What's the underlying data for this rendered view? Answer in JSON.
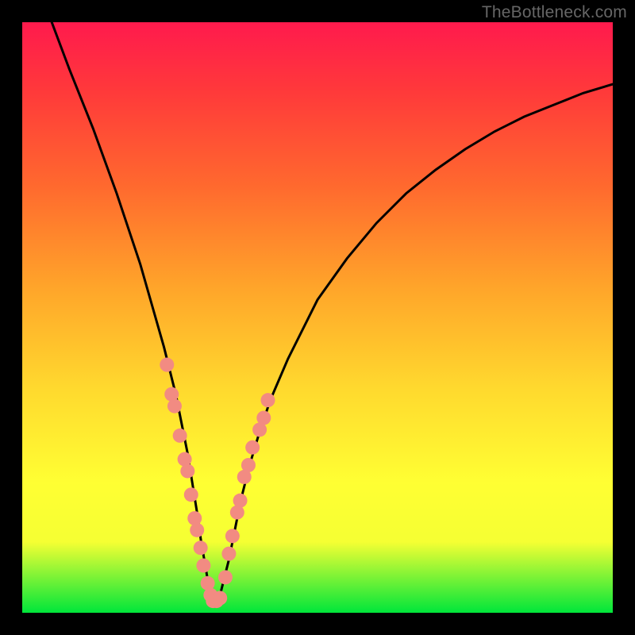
{
  "watermark": "TheBottleneck.com",
  "chart_data": {
    "type": "line",
    "title": "",
    "xlabel": "",
    "ylabel": "",
    "xlim": [
      0,
      100
    ],
    "ylim": [
      0,
      100
    ],
    "series": [
      {
        "name": "bottleneck-curve",
        "x": [
          5,
          8,
          12,
          16,
          20,
          22,
          24,
          26,
          27,
          28,
          28.8,
          29.6,
          30.3,
          31,
          31.5,
          32,
          32.5,
          33,
          33.5,
          34,
          35,
          36,
          37,
          38.5,
          40,
          42,
          45,
          50,
          55,
          60,
          65,
          70,
          75,
          80,
          85,
          90,
          95,
          100
        ],
        "values": [
          100,
          92,
          82,
          71,
          59,
          52,
          45,
          37,
          32,
          27,
          22,
          17,
          12,
          8,
          5,
          3,
          2,
          2,
          3,
          5,
          9,
          14,
          19,
          25,
          30,
          36,
          43,
          53,
          60,
          66,
          71,
          75,
          78.5,
          81.5,
          84,
          86,
          88,
          89.5
        ]
      }
    ],
    "markers": {
      "name": "sample-points",
      "color": "#f28b82",
      "points": [
        {
          "x": 24.5,
          "y": 42
        },
        {
          "x": 25.3,
          "y": 37
        },
        {
          "x": 25.8,
          "y": 35
        },
        {
          "x": 26.7,
          "y": 30
        },
        {
          "x": 27.5,
          "y": 26
        },
        {
          "x": 28,
          "y": 24
        },
        {
          "x": 28.6,
          "y": 20
        },
        {
          "x": 29.2,
          "y": 16
        },
        {
          "x": 29.6,
          "y": 14
        },
        {
          "x": 30.2,
          "y": 11
        },
        {
          "x": 30.7,
          "y": 8
        },
        {
          "x": 31.4,
          "y": 5
        },
        {
          "x": 31.9,
          "y": 3
        },
        {
          "x": 32.3,
          "y": 2
        },
        {
          "x": 32.9,
          "y": 2
        },
        {
          "x": 33.5,
          "y": 2.5
        },
        {
          "x": 34.4,
          "y": 6
        },
        {
          "x": 35,
          "y": 10
        },
        {
          "x": 35.6,
          "y": 13
        },
        {
          "x": 36.4,
          "y": 17
        },
        {
          "x": 36.9,
          "y": 19
        },
        {
          "x": 37.6,
          "y": 23
        },
        {
          "x": 38.3,
          "y": 25
        },
        {
          "x": 39,
          "y": 28
        },
        {
          "x": 40.2,
          "y": 31
        },
        {
          "x": 40.9,
          "y": 33
        },
        {
          "x": 41.6,
          "y": 36
        }
      ]
    },
    "background_gradient": {
      "top": "#ff1a4d",
      "mid": "#ffd92e",
      "bottom": "#00e63a"
    }
  }
}
